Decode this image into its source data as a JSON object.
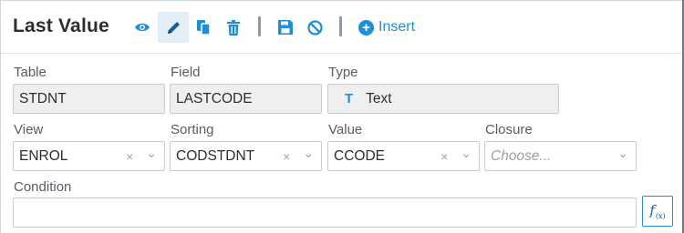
{
  "header": {
    "title": "Last Value",
    "insert_label": "Insert",
    "accent_color": "#1d8fd6"
  },
  "toolbar_icons": [
    "eye-icon",
    "pencil-icon",
    "copy-icon",
    "trash-icon",
    "save-icon",
    "cancel-icon",
    "plus-circle-icon"
  ],
  "fields": {
    "table": {
      "label": "Table",
      "value": "STDNT"
    },
    "field": {
      "label": "Field",
      "value": "LASTCODE"
    },
    "type": {
      "label": "Type",
      "icon": "T",
      "value": "Text"
    },
    "view": {
      "label": "View",
      "value": "ENROL",
      "clear": "×",
      "caret": "⌄"
    },
    "sorting": {
      "label": "Sorting",
      "value": "CODSTDNT",
      "clear": "×",
      "caret": "⌄"
    },
    "value": {
      "label": "Value",
      "value": "CCODE",
      "clear": "×",
      "caret": "⌄"
    },
    "closure": {
      "label": "Closure",
      "placeholder": "Choose...",
      "caret": "⌄"
    },
    "condition": {
      "label": "Condition",
      "value": ""
    }
  },
  "fx": {
    "label": "f",
    "sub": "(x)"
  }
}
